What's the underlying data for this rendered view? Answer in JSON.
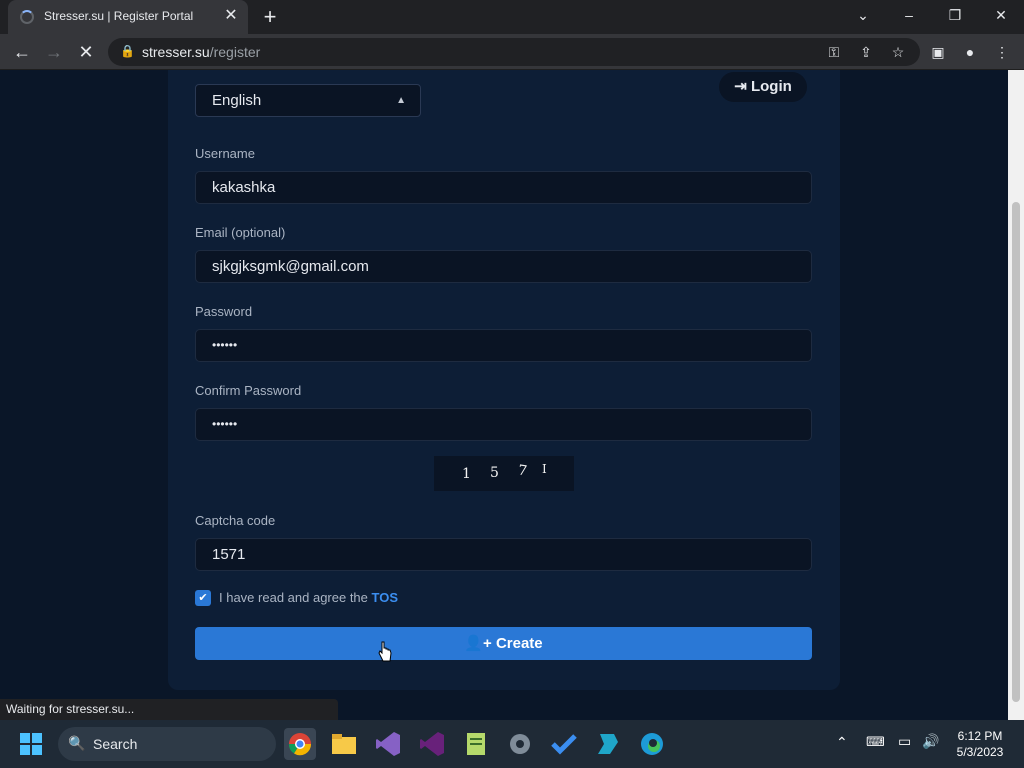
{
  "browser": {
    "tab_title": "Stresser.su | Register Portal",
    "url_host": "stresser.su",
    "url_path": "/register",
    "status_text": "Waiting for stresser.su..."
  },
  "form": {
    "language": "English",
    "login_label": "Login",
    "username_label": "Username",
    "username_value": "kakashka",
    "email_label": "Email (optional)",
    "email_value": "sjkgjksgmk@gmail.com",
    "password_label": "Password",
    "password_value": "••••••",
    "confirm_label": "Confirm Password",
    "confirm_value": "••••••",
    "captcha_digits": [
      "1",
      "5",
      "7",
      "I"
    ],
    "captcha_label": "Captcha code",
    "captcha_value": "1571",
    "tos_text": "I have read and agree the ",
    "tos_link": "TOS",
    "tos_checked": true,
    "create_label": "Create"
  },
  "taskbar": {
    "search_label": "Search",
    "time": "6:12 PM",
    "date": "5/3/2023"
  },
  "colors": {
    "accent": "#2a78d6",
    "page_bg": "#0a1628",
    "card_bg": "#0d1e36"
  }
}
